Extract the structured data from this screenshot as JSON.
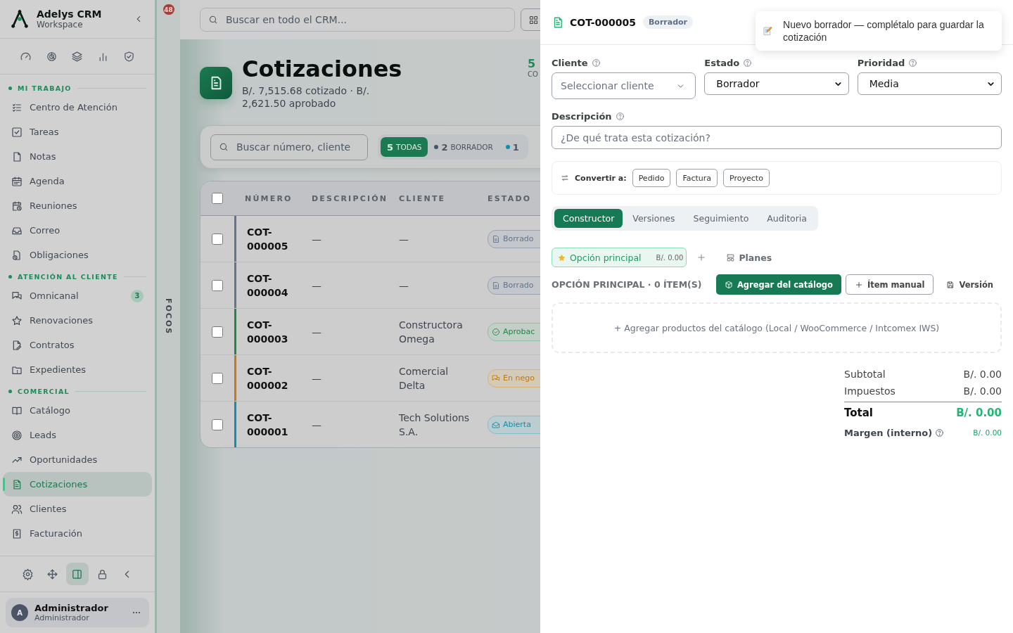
{
  "sidebar": {
    "brand": {
      "name": "Adelys CRM",
      "subtitle": "Workspace"
    },
    "sections": [
      {
        "title": "MI TRABAJO",
        "items": [
          {
            "label": "Centro de Atención",
            "selected": false
          },
          {
            "label": "Tareas",
            "selected": false
          },
          {
            "label": "Notas",
            "selected": false
          },
          {
            "label": "Agenda",
            "selected": false
          },
          {
            "label": "Reuniones",
            "selected": false
          },
          {
            "label": "Correo",
            "selected": false
          },
          {
            "label": "Obligaciones",
            "selected": false
          }
        ]
      },
      {
        "title": "ATENCIÓN AL CLIENTE",
        "items": [
          {
            "label": "Omnicanal",
            "selected": false,
            "badge": "3"
          },
          {
            "label": "Renovaciones",
            "selected": false
          },
          {
            "label": "Contratos",
            "selected": false
          },
          {
            "label": "Expedientes",
            "selected": false
          }
        ]
      },
      {
        "title": "COMERCIAL",
        "items": [
          {
            "label": "Catálogo",
            "selected": false
          },
          {
            "label": "Leads",
            "selected": false
          },
          {
            "label": "Oportunidades",
            "selected": false
          },
          {
            "label": "Cotizaciones",
            "selected": true
          },
          {
            "label": "Clientes",
            "selected": false
          },
          {
            "label": "Facturación",
            "selected": false
          }
        ]
      }
    ],
    "tools": [
      {
        "selected": false
      },
      {
        "selected": false
      },
      {
        "selected": true
      },
      {
        "selected": false
      },
      {
        "selected": false
      }
    ],
    "user": {
      "initial": "A",
      "name": "Administrador",
      "role": "Administrador"
    }
  },
  "rail": {
    "badge": "48",
    "label": "FOCOS"
  },
  "topbar": {
    "search_placeholder": "Buscar en todo el CRM..."
  },
  "page": {
    "title": "Cotizaciones",
    "subtitle": "B/. 7,515.68 cotizado · B/. 2,621.50 aprobado",
    "stat": {
      "value": "5",
      "label": "CO"
    }
  },
  "filters": {
    "search_placeholder": "Buscar número, cliente",
    "chips": [
      {
        "count": "5",
        "label": "TODAS",
        "selected": true
      },
      {
        "count": "2",
        "label": "BORRADOR",
        "selected": false,
        "color": "#475569"
      },
      {
        "count": "1",
        "selected": false,
        "color": "#0891b2"
      }
    ]
  },
  "table": {
    "select_all": {
      "checked": false
    },
    "columns": [
      "NÚMERO",
      "DESCRIPCIÓN",
      "CLIENTE",
      "ESTADO"
    ],
    "rows": [
      {
        "checked": false,
        "number": "COT-000005",
        "description": "—",
        "client": "—",
        "status": {
          "label": "Borrado",
          "kind": "draft"
        }
      },
      {
        "checked": false,
        "number": "COT-000004",
        "description": "—",
        "client": "—",
        "status": {
          "label": "Borrado",
          "kind": "draft"
        }
      },
      {
        "checked": false,
        "number": "COT-000003",
        "description": "—",
        "client": "Constructora Omega",
        "status": {
          "label": "Aprobac",
          "kind": "approved"
        }
      },
      {
        "checked": false,
        "number": "COT-000002",
        "description": "—",
        "client": "Comercial Delta",
        "status": {
          "label": "En nego",
          "kind": "negotiation"
        }
      },
      {
        "checked": false,
        "number": "COT-000001",
        "description": "—",
        "client": "Tech Solutions S.A.",
        "status": {
          "label": "Abierta",
          "kind": "open"
        }
      }
    ]
  },
  "drawer": {
    "number": "COT-000005",
    "badge": "Borrador",
    "toast": {
      "text": "Nuevo borrador — complétalo para guardar la cotización"
    },
    "fields": [
      {
        "label": "Cliente",
        "kind": "combobox",
        "placeholder": "Seleccionar cliente"
      },
      {
        "label": "Estado",
        "kind": "select",
        "value": "Borrador"
      },
      {
        "label": "Prioridad",
        "kind": "select",
        "value": "Media"
      }
    ],
    "description": {
      "label": "Descripción",
      "placeholder": "¿De qué trata esta cotización?"
    },
    "convert": {
      "label": "Convertir a:",
      "buttons": [
        "Pedido",
        "Factura",
        "Proyecto"
      ]
    },
    "tabs": [
      {
        "label": "Constructor",
        "selected": true
      },
      {
        "label": "Versiones",
        "selected": false
      },
      {
        "label": "Seguimiento",
        "selected": false
      },
      {
        "label": "Auditoria",
        "selected": false
      }
    ],
    "options": [
      {
        "label": "Opción principal",
        "amount": "B/. 0.00",
        "selected": true
      }
    ],
    "plans": "Planes",
    "section_title": "OPCIÓN PRINCIPAL · 0 ÍTEM(S)",
    "actions": [
      {
        "label": "Agregar del catálogo",
        "kind": "primary"
      },
      {
        "label": "Ítem manual",
        "kind": "outline"
      },
      {
        "label": "Versión",
        "kind": "ghost"
      }
    ],
    "empty_text": "+ Agregar productos del catálogo (Local / WooCommerce / Intcomex IWS)",
    "totals": [
      {
        "label": "Subtotal",
        "value": "B/. 0.00",
        "kind": "normal"
      },
      {
        "label": "Impuestos",
        "value": "B/. 0.00",
        "kind": "normal"
      },
      {
        "label": "Total",
        "value": "B/. 0.00",
        "kind": "total"
      },
      {
        "label": "Margen (interno)",
        "value": "B/. 0.00",
        "kind": "margin"
      }
    ]
  }
}
